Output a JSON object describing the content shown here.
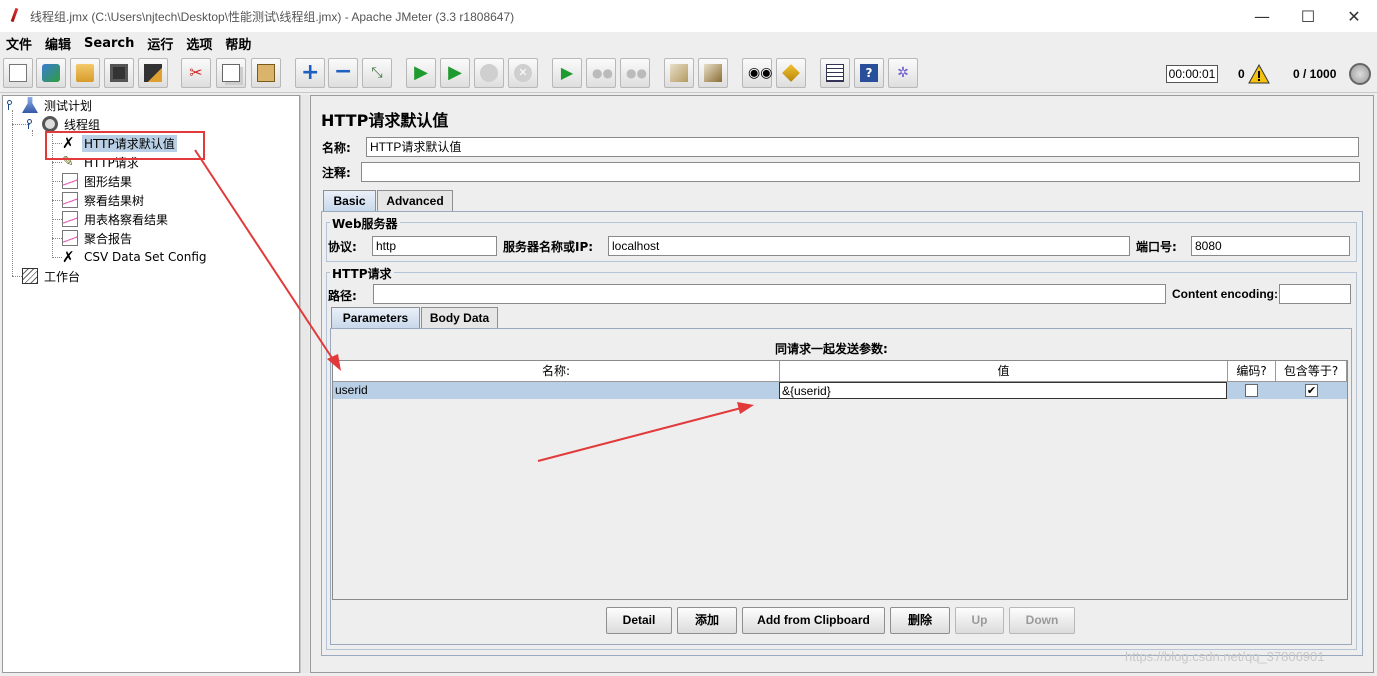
{
  "window": {
    "title": "线程组.jmx (C:\\Users\\njtech\\Desktop\\性能测试\\线程组.jmx) - Apache JMeter (3.3 r1808647)",
    "minimize": "—",
    "maximize": "☐",
    "close": "✕"
  },
  "menu": [
    "文件",
    "编辑",
    "Search",
    "运行",
    "选项",
    "帮助"
  ],
  "toolbar": {
    "icons": [
      "new-icon",
      "templates-icon",
      "open-icon",
      "save-icon",
      "save-as-icon",
      "cut-icon",
      "copy-icon",
      "paste-icon",
      "expand-icon",
      "collapse-icon",
      "toggle-icon",
      "start-icon",
      "start-no-timers-icon",
      "stop-icon",
      "shutdown-icon",
      "remote-start-icon",
      "remote-stop-icon",
      "remote-shutdown-icon",
      "clear-icon",
      "clear-all-icon",
      "search-icon",
      "reset-search-icon",
      "function-helper-icon",
      "help-icon",
      "log-viewer-icon"
    ],
    "timer": "00:00:01",
    "error_count": "0",
    "thread_count": "0 / 1000"
  },
  "tree": {
    "test_plan": "测试计划",
    "thread_group": "线程组",
    "items": [
      "HTTP请求默认值",
      "HTTP请求",
      "图形结果",
      "察看结果树",
      "用表格察看结果",
      "聚合报告",
      "CSV Data Set Config"
    ],
    "workbench": "工作台"
  },
  "panel": {
    "title": "HTTP请求默认值",
    "name_label": "名称:",
    "name_value": "HTTP请求默认值",
    "comment_label": "注释:",
    "comment_value": "",
    "tabs": [
      "Basic",
      "Advanced"
    ],
    "web_server": {
      "title": "Web服务器",
      "protocol_label": "协议:",
      "protocol_value": "http",
      "server_label": "服务器名称或IP:",
      "server_value": "localhost",
      "port_label": "端口号:",
      "port_value": "8080"
    },
    "http_request": {
      "title": "HTTP请求",
      "path_label": "路径:",
      "path_value": "",
      "encoding_label": "Content encoding:",
      "encoding_value": ""
    },
    "sub_tabs": [
      "Parameters",
      "Body Data"
    ],
    "params_caption": "同请求一起发送参数:",
    "columns": [
      "名称:",
      "值",
      "编码?",
      "包含等于?"
    ],
    "rows": [
      {
        "name": "userid",
        "value": "&{userid}",
        "encode": false,
        "include_equals": true
      }
    ],
    "buttons": [
      "Detail",
      "添加",
      "Add from Clipboard",
      "删除",
      "Up",
      "Down"
    ]
  },
  "watermark": "https://blog.csdn.net/qq_37806901",
  "colors": {
    "selection": "#b8cfe5",
    "annotation": "#e23a3a"
  }
}
